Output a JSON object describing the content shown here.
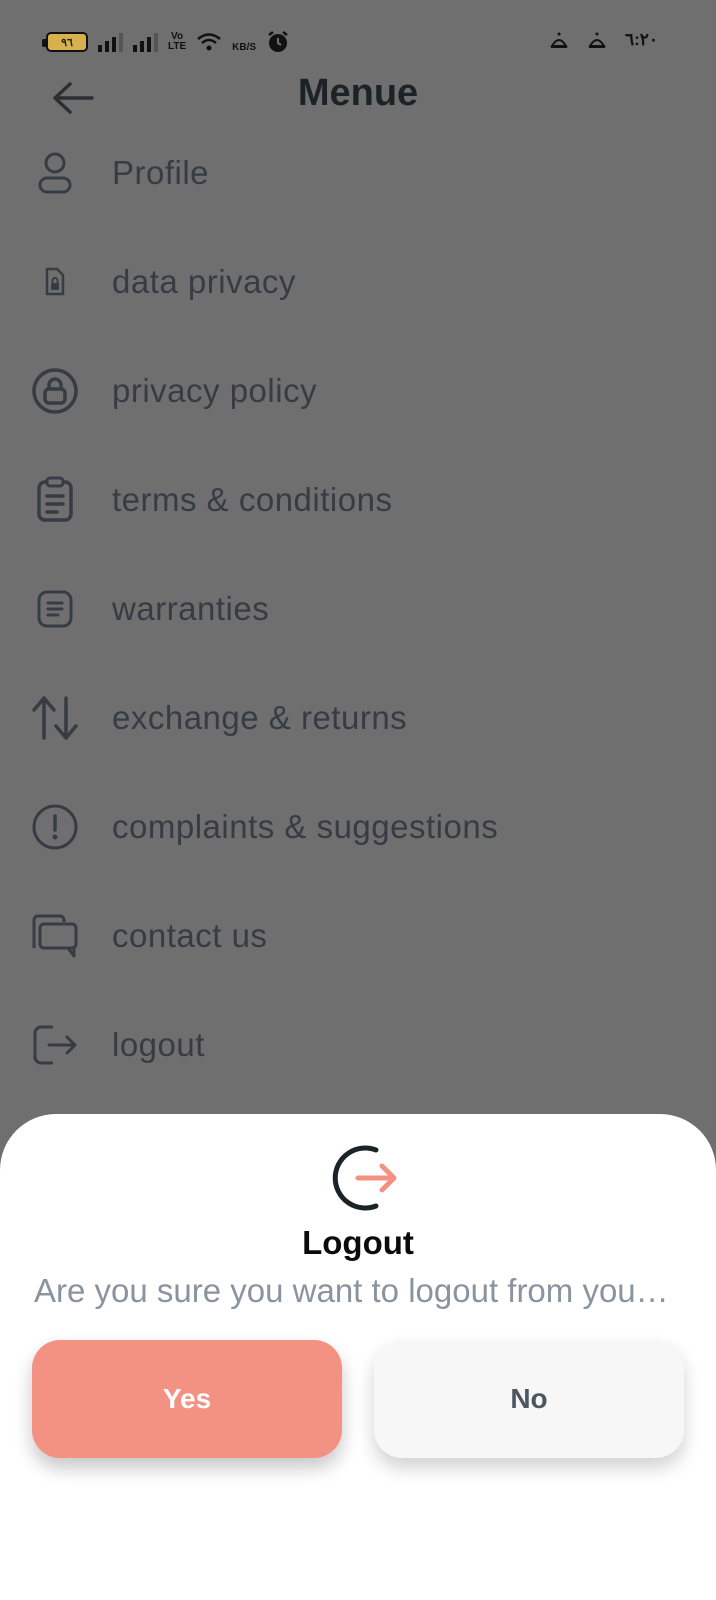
{
  "status_bar": {
    "battery_level": "٩٦",
    "volte_top": "Vo",
    "volte_bottom": "LTE",
    "speed_unit": "KB/S",
    "time": "٦:٢٠",
    "icons": [
      "battery-icon",
      "signal-icon",
      "signal-icon",
      "volte-icon",
      "wifi-icon",
      "alarm-icon",
      "notification-icon",
      "notification-icon"
    ]
  },
  "header": {
    "title": "Menue",
    "back_icon": "arrow-left-icon"
  },
  "menu": {
    "items": [
      {
        "label": "Profile",
        "icon": "user-icon"
      },
      {
        "label": "data privacy",
        "icon": "file-lock-icon"
      },
      {
        "label": "privacy policy",
        "icon": "lock-circle-icon"
      },
      {
        "label": "terms & conditions",
        "icon": "clipboard-icon"
      },
      {
        "label": "warranties",
        "icon": "document-icon"
      },
      {
        "label": "exchange & returns",
        "icon": "exchange-arrows-icon"
      },
      {
        "label": "complaints & suggestions",
        "icon": "alert-circle-icon"
      },
      {
        "label": "contact us",
        "icon": "chat-icon"
      },
      {
        "label": "logout",
        "icon": "logout-icon"
      }
    ]
  },
  "dialog": {
    "title": "Logout",
    "message": "Are you sure you want to logout from your account?",
    "yes_label": "Yes",
    "no_label": "No",
    "accent_color": "#f39283",
    "icon": "logout-icon"
  }
}
